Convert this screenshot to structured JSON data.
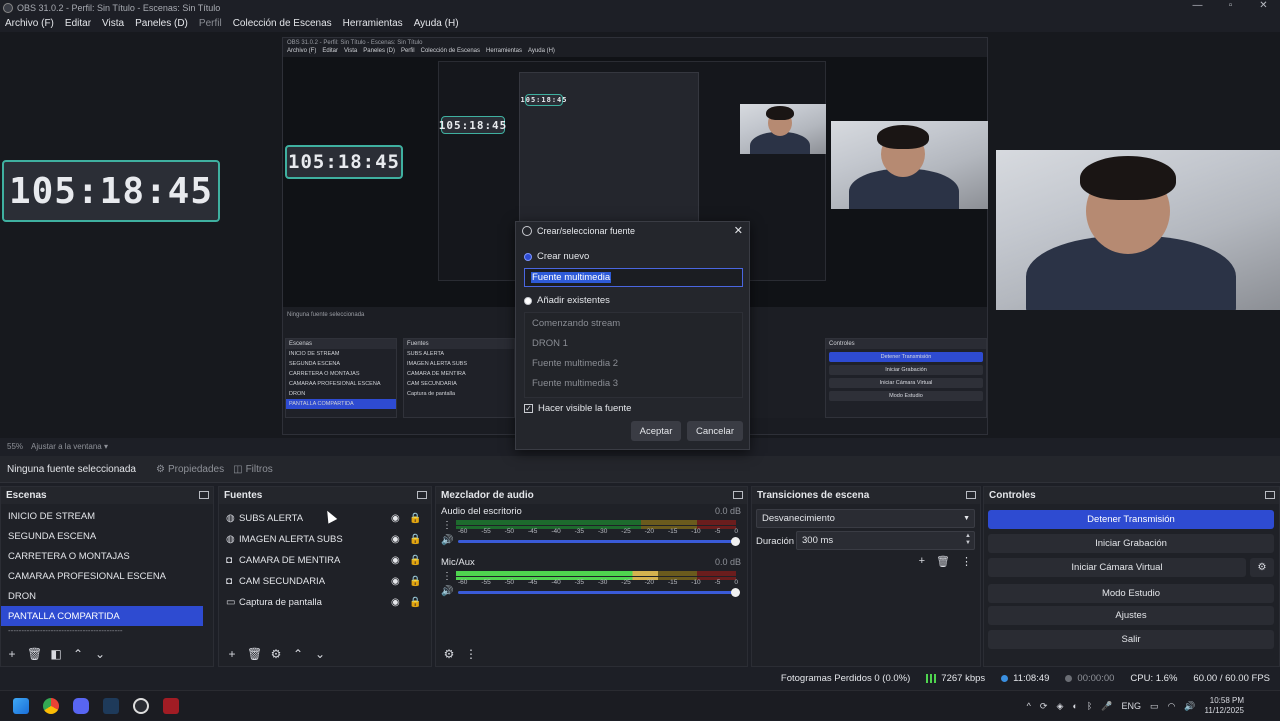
{
  "window": {
    "title": "OBS 31.0.2 - Perfil: Sin Título - Escenas: Sin Título",
    "controls": [
      "—",
      "▫",
      "✕"
    ]
  },
  "menu": [
    "Archivo (F)",
    "Editar",
    "Vista",
    "Paneles (D)",
    "Perfil",
    "Colección de Escenas",
    "Herramientas",
    "Ayuda (H)"
  ],
  "preview": {
    "timer_text": "105:18:45",
    "zoom": "55%",
    "zoom_mode": "Ajustar a la ventana"
  },
  "source_toolbar": {
    "none_selected": "Ninguna fuente seleccionada",
    "properties": "Propiedades",
    "filters": "Filtros"
  },
  "scenes": {
    "title": "Escenas",
    "items": [
      "INICIO DE STREAM",
      "SEGUNDA ESCENA",
      "CARRETERA O MONTAJAS",
      "CAMARAA PROFESIONAL ESCENA",
      "DRON",
      "PANTALLA COMPARTIDA"
    ],
    "selected_index": 5,
    "separator": "-------------------------------------------"
  },
  "sources": {
    "title": "Fuentes",
    "items": [
      {
        "label": "SUBS ALERTA",
        "icon": "globe-icon"
      },
      {
        "label": "IMAGEN ALERTA SUBS",
        "icon": "globe-icon"
      },
      {
        "label": "CAMARA DE MENTIRA",
        "icon": "camera-icon"
      },
      {
        "label": "CAM SECUNDARIA",
        "icon": "camera-icon"
      },
      {
        "label": "Captura de pantalla",
        "icon": "monitor-icon"
      }
    ]
  },
  "mixer": {
    "title": "Mezclador de audio",
    "scale": [
      "-60",
      "-55",
      "-50",
      "-45",
      "-40",
      "-35",
      "-30",
      "-25",
      "-20",
      "-15",
      "-10",
      "-5",
      "0"
    ],
    "channels": [
      {
        "name": "Audio del escritorio",
        "db": "0.0 dB",
        "level": 0.0
      },
      {
        "name": "Mic/Aux",
        "db": "0.0 dB",
        "level": 0.72
      }
    ]
  },
  "transitions": {
    "title": "Transiciones de escena",
    "selected": "Desvanecimiento",
    "duration_label": "Duración",
    "duration_value": "300 ms"
  },
  "controls": {
    "title": "Controles",
    "stop_stream": "Detener Transmisión",
    "start_recording": "Iniciar Grabación",
    "start_virtual_cam": "Iniciar Cámara Virtual",
    "studio_mode": "Modo Estudio",
    "settings": "Ajustes",
    "exit": "Salir"
  },
  "status": {
    "dropped_frames": "Fotogramas Perdidos 0 (0.0%)",
    "bitrate": "7267 kbps",
    "stream_time": "11:08:49",
    "rec_time": "00:00:00",
    "cpu": "CPU: 1.6%",
    "fps": "60.00 / 60.00 FPS"
  },
  "dialog": {
    "title": "Crear/seleccionar fuente",
    "create_new": "Crear nuevo",
    "name_value": "Fuente multimedia",
    "add_existing": "Añadir existentes",
    "existing": [
      "Comenzando stream",
      "DRON 1",
      "Fuente multimedia 2",
      "Fuente multimedia 3"
    ],
    "visible_label": "Hacer visible la fuente",
    "accept": "Aceptar",
    "cancel": "Cancelar"
  },
  "taskbar": {
    "lang": "ENG",
    "time": "10:58 PM",
    "date": "11/12/2025"
  },
  "colors": {
    "accent": "#2e4bd1",
    "meter_green": "#4fd44f",
    "teal": "#3fb0a0"
  }
}
